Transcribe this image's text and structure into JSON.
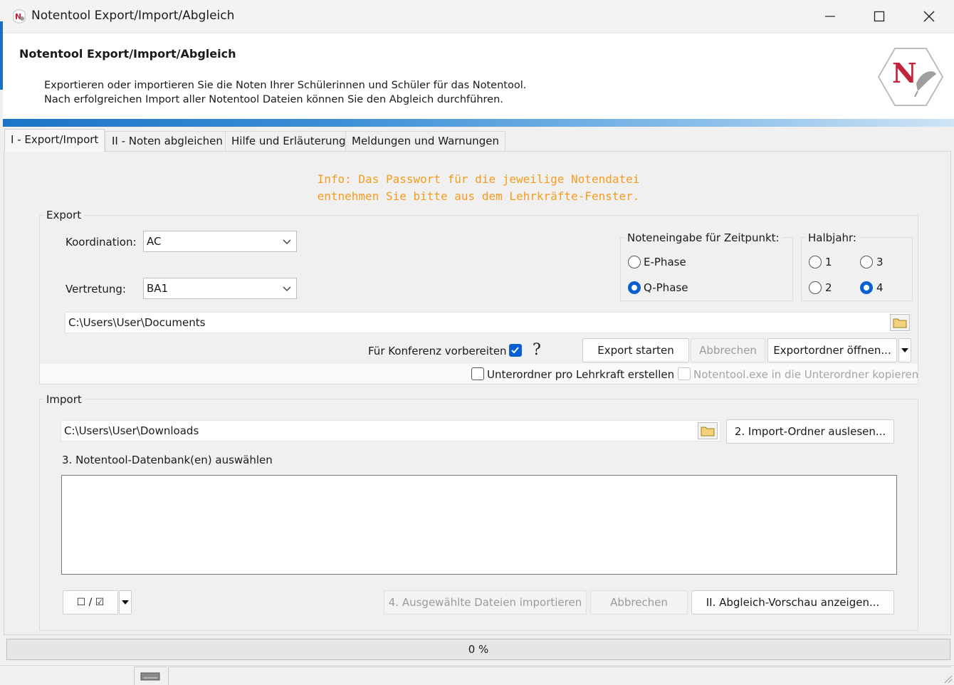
{
  "window": {
    "title": "Notentool Export/Import/Abgleich",
    "controls": {
      "minimize": "minimize-icon",
      "maximize": "maximize-icon",
      "close": "close-icon"
    }
  },
  "header": {
    "title": "Notentool Export/Import/Abgleich",
    "line1": "Exportieren oder importieren Sie die Noten Ihrer Schülerinnen und Schüler für das Notentool.",
    "line2": "Nach erfolgreichen Import aller Notentool Dateien können Sie den Abgleich durchführen.",
    "logo_letter": "N"
  },
  "tabs": [
    {
      "label": "I - Export/Import",
      "active": true
    },
    {
      "label": "II - Noten abgleichen",
      "active": false
    },
    {
      "label": "Hilfe und Erläuterung",
      "active": false
    },
    {
      "label": "Meldungen und Warnungen",
      "active": false
    }
  ],
  "info": {
    "line1": "Info: Das Passwort für die jeweilige Notendatei",
    "line2": "entnehmen Sie bitte aus dem Lehrkräfte-Fenster."
  },
  "export": {
    "group_label": "Export",
    "koordination_label": "Koordination:",
    "koordination_value": "AC",
    "vertretung_label": "Vertretung:",
    "vertretung_value": "BA1",
    "zeitpunkt_label": "Noteneingabe für Zeitpunkt:",
    "zeitpunkt_options": [
      {
        "label": "E-Phase",
        "selected": false
      },
      {
        "label": "Q-Phase",
        "selected": true
      }
    ],
    "halbjahr_label": "Halbjahr:",
    "halbjahr_options": [
      {
        "label": "1",
        "selected": false
      },
      {
        "label": "3",
        "selected": false
      },
      {
        "label": "2",
        "selected": false
      },
      {
        "label": "4",
        "selected": true
      }
    ],
    "path": "C:\\Users\\User\\Documents",
    "konferenz_label": "Für Konferenz vorbereiten",
    "konferenz_checked": true,
    "help_glyph": "?",
    "start_button": "Export starten",
    "cancel_button": "Abbrechen",
    "open_folder_button": "Exportordner öffnen...",
    "unterordner_label": "Unterordner pro Lehrkraft erstellen",
    "unterordner_checked": false,
    "kopieren_label": "Notentool.exe in die Unterordner kopieren",
    "kopieren_checked": false
  },
  "import": {
    "group_label": "Import",
    "path": "C:\\Users\\User\\Downloads",
    "read_button": "2. Import-Ordner auslesen...",
    "db_label": "3. Notentool-Datenbank(en) auswählen",
    "select_toggle_label": "☐ / ☑",
    "import_button": "4. Ausgewählte Dateien importieren",
    "cancel_button": "Abbrechen",
    "preview_button": "II. Abgleich-Vorschau anzeigen..."
  },
  "progress": {
    "text": "0 %",
    "value": 0
  },
  "colors": {
    "accent": "#0a5fd1",
    "info": "#f39c1f",
    "logo": "#c0243a"
  }
}
